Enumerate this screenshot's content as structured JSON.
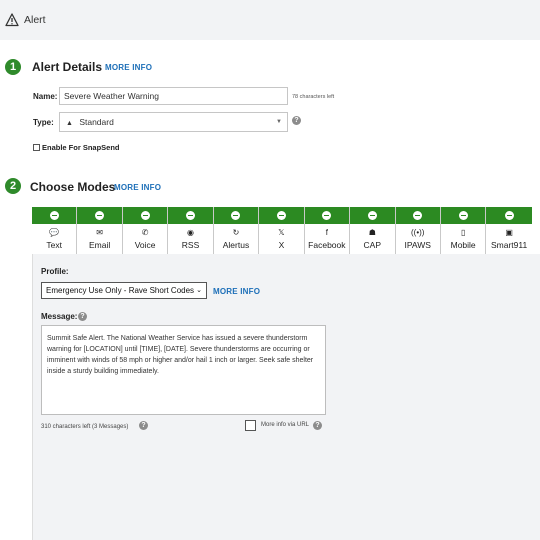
{
  "header": {
    "title": "Alert"
  },
  "alert_details": {
    "step": "1",
    "heading": "Alert Details",
    "more_info": "MORE INFO",
    "name_label": "Name:",
    "name_value": "Severe Weather Warning",
    "chars_left": "78 characters left",
    "type_label": "Type:",
    "type_value": "Standard",
    "snapsend_label": "Enable For SnapSend"
  },
  "choose_modes": {
    "step": "2",
    "heading": "Choose Modes",
    "more_info": "MORE INFO",
    "modes": [
      {
        "name": "Text",
        "icon": "speech-bubble-icon",
        "glyph": "💬"
      },
      {
        "name": "Email",
        "icon": "envelope-icon",
        "glyph": "✉"
      },
      {
        "name": "Voice",
        "icon": "phone-icon",
        "glyph": "✆"
      },
      {
        "name": "RSS",
        "icon": "rss-icon",
        "glyph": "◉"
      },
      {
        "name": "Alertus",
        "icon": "alertus-icon",
        "glyph": "↻"
      },
      {
        "name": "X",
        "icon": "x-logo-icon",
        "glyph": "𝕏"
      },
      {
        "name": "Facebook",
        "icon": "facebook-icon",
        "glyph": "f"
      },
      {
        "name": "CAP",
        "icon": "cap-icon",
        "glyph": "☗"
      },
      {
        "name": "IPAWS",
        "icon": "broadcast-icon",
        "glyph": "((•))"
      },
      {
        "name": "Mobile",
        "icon": "mobile-icon",
        "glyph": "▯"
      },
      {
        "name": "Smart911",
        "icon": "smart911-icon",
        "glyph": "▣"
      }
    ]
  },
  "text_panel": {
    "profile_label": "Profile:",
    "profile_value": "Emergency Use Only - Rave Short Codes",
    "profile_more_info": "MORE INFO",
    "message_label": "Message:",
    "message": "Summit Safe Alert. The National Weather Service has issued a severe thunderstorm warning for [LOCATION] until [TIME], [DATE]. Severe thunderstorms are occurring or imminent with winds of 58 mph or higher and/or hail 1 inch or larger. Seek safe shelter inside a sturdy building immediately.",
    "chars_left": "310 characters left (3 Messages)",
    "more_info_url": "More info via URL"
  },
  "colors": {
    "accent_green": "#2c8a22",
    "link_blue": "#1d6fb8"
  }
}
